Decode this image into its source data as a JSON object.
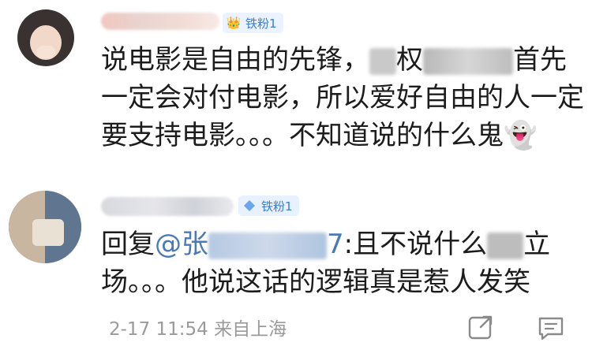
{
  "comment1": {
    "badge": "铁粉1",
    "text_part1": "说电影是自由的先锋，",
    "text_part2": "权",
    "text_part3": "首先一定会对付电影，所以爱好自由的人一定要支持电影。。。不知道说的什么鬼",
    "emoji": "👻"
  },
  "comment2": {
    "badge": "铁粉1",
    "reply_prefix": "回复",
    "mention_start": "@张",
    "mention_end": "7",
    "text_part1": ":且不说什么",
    "text_part2": "立场。。。他说这话的逻辑真是惹人发笑"
  },
  "footer": {
    "timestamp": "2-17 11:54",
    "source": "来自上海"
  },
  "icons": {
    "badge1": "crown-icon",
    "badge2": "diamond-icon",
    "share": "share-icon",
    "comment": "comment-icon"
  },
  "colors": {
    "badge_text": "#3a7bd5",
    "mention": "#4a79b8",
    "footer": "#9a9a9a"
  }
}
